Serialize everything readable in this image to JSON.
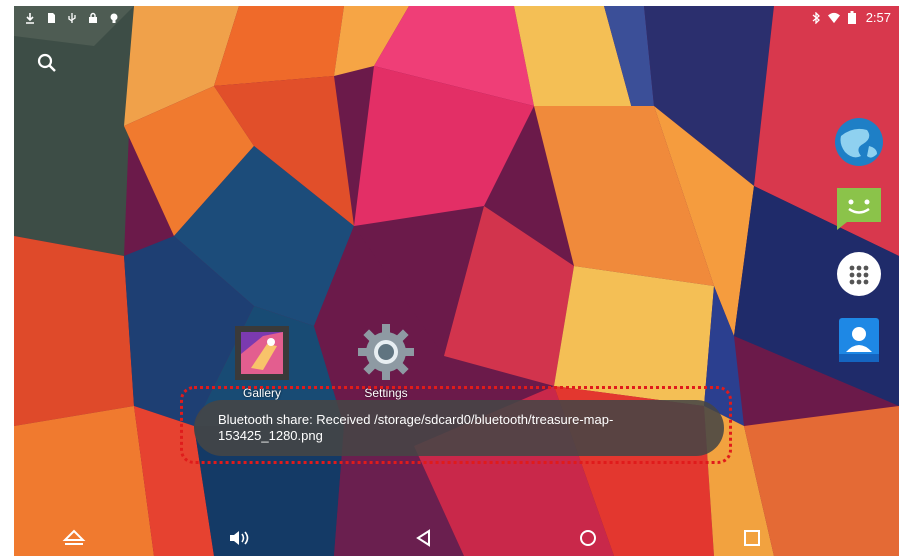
{
  "status_bar": {
    "time": "2:57",
    "left_icons": [
      "download-icon",
      "sd-card-icon",
      "usb-icon",
      "lock-icon",
      "bulb-icon"
    ],
    "right_icons": [
      "bluetooth-icon",
      "wifi-icon",
      "battery-icon"
    ]
  },
  "home": {
    "search_icon": "search-icon",
    "apps": [
      {
        "label": "Gallery",
        "icon": "gallery-icon"
      },
      {
        "label": "Settings",
        "icon": "gear-icon"
      }
    ],
    "dock": [
      {
        "label": "Browser",
        "icon": "globe-icon"
      },
      {
        "label": "Messaging",
        "icon": "message-smile-icon"
      },
      {
        "label": "Apps",
        "icon": "app-drawer-icon"
      },
      {
        "label": "Contacts",
        "icon": "contacts-icon"
      }
    ]
  },
  "toast": {
    "message": "Bluetooth share: Received /storage/sdcard0/bluetooth/treasure-map-153425_1280.png"
  },
  "nav_bar": {
    "buttons": [
      "eject-icon",
      "volume-icon",
      "back-icon",
      "home-icon",
      "recents-icon"
    ]
  },
  "colors": {
    "toast_bg": "#464646",
    "highlight": "#e01b1b",
    "accent": "#ffffff"
  }
}
